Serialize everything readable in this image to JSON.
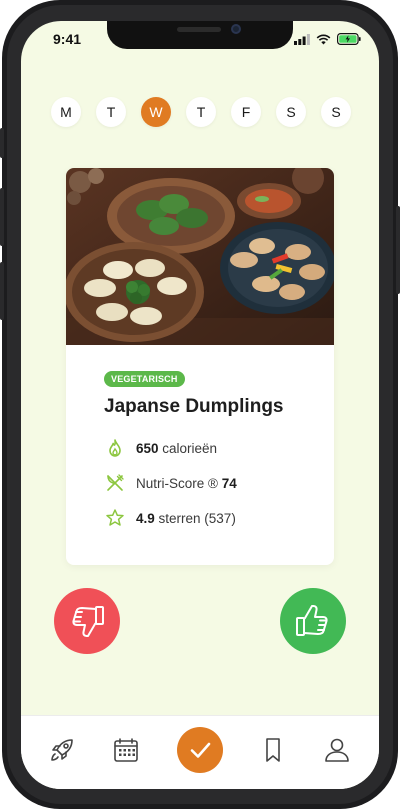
{
  "status_bar": {
    "time": "9:41"
  },
  "week_days": [
    {
      "letter": "M",
      "active": false
    },
    {
      "letter": "T",
      "active": false
    },
    {
      "letter": "W",
      "active": true
    },
    {
      "letter": "T",
      "active": false
    },
    {
      "letter": "F",
      "active": false
    },
    {
      "letter": "S",
      "active": false
    },
    {
      "letter": "S",
      "active": false
    }
  ],
  "meal": {
    "badge": "VEGETARISCH",
    "title": "Japanse Dumplings",
    "calories_value": "650",
    "calories_label": " calorieën",
    "nutri_label": "Nutri-Score ® ",
    "nutri_value": "74",
    "rating_value": "4.9",
    "rating_label": " sterren (537)"
  },
  "colors": {
    "accent": "#e07b22",
    "background": "#f5fae4",
    "badge": "#5cb84a",
    "dislike": "#f05057",
    "like": "#42b955",
    "icon_green": "#8cc63f"
  },
  "icons": {
    "calories": "flame-icon",
    "nutri": "fork-knife-icon",
    "rating": "star-icon",
    "dislike": "thumbs-down-icon",
    "like": "thumbs-up-icon",
    "tabs": [
      "rocket-icon",
      "calendar-icon",
      "check-icon",
      "bookmark-icon",
      "profile-icon"
    ]
  }
}
